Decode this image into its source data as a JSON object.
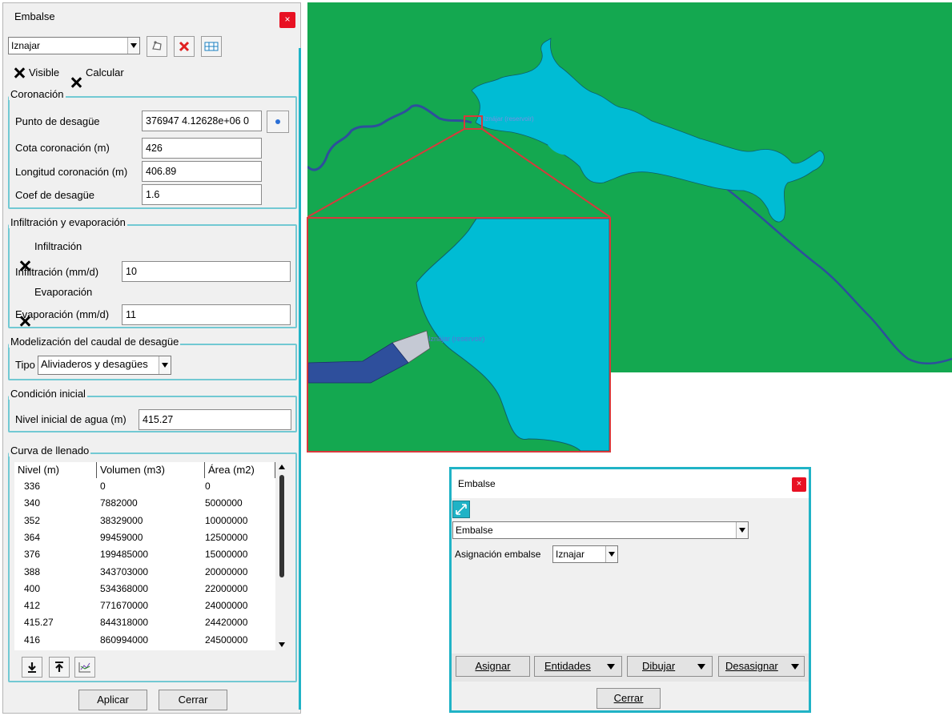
{
  "main_dialog": {
    "title": "Embalse",
    "close_glyph": "×",
    "reservoir_select": "Iznajar",
    "toolbar_icons": [
      "draw-polygon-icon",
      "delete-icon",
      "table-icon"
    ],
    "visible_label": "Visible",
    "calcular_label": "Calcular",
    "coronacion": {
      "title": "Coronación",
      "punto_label": "Punto de desagüe",
      "punto_value": "376947 4.12628e+06 0",
      "cota_label": "Cota coronación (m)",
      "cota_value": "426",
      "longitud_label": "Longitud coronación (m)",
      "longitud_value": "406.89",
      "coef_label": "Coef de desagüe",
      "coef_value": "1.6"
    },
    "infiltracion": {
      "title": "Infiltración y evaporación",
      "infil_check_label": "Infiltración",
      "infil_label": "Infiltración (mm/d)",
      "infil_value": "10",
      "evap_check_label": "Evaporación",
      "evap_label": "Evaporación (mm/d)",
      "evap_value": "11"
    },
    "modelizacion": {
      "title": "Modelización del caudal de desagüe",
      "tipo_label": "Tipo",
      "tipo_value": "Aliviaderos y desagües"
    },
    "condicion": {
      "title": "Condición inicial",
      "nivel_label": "Nivel inicial de agua (m)",
      "nivel_value": "415.27"
    },
    "curva": {
      "title": "Curva de llenado",
      "headers": [
        "Nivel (m)",
        "Volumen (m3)",
        "Área (m2)"
      ],
      "rows": [
        [
          "336",
          "0",
          "0"
        ],
        [
          "340",
          "7882000",
          "5000000"
        ],
        [
          "352",
          "38329000",
          "10000000"
        ],
        [
          "364",
          "99459000",
          "12500000"
        ],
        [
          "376",
          "199485000",
          "15000000"
        ],
        [
          "388",
          "343703000",
          "20000000"
        ],
        [
          "400",
          "534368000",
          "22000000"
        ],
        [
          "412",
          "771670000",
          "24000000"
        ],
        [
          "415.27",
          "844318000",
          "24420000"
        ],
        [
          "416",
          "860994000",
          "24500000"
        ]
      ],
      "bottom_icons": [
        "import-icon",
        "export-icon",
        "chart-icon"
      ]
    },
    "aplicar_label": "Aplicar",
    "cerrar_label": "Cerrar"
  },
  "map": {
    "label": "Iznájar (reservoir)"
  },
  "colors": {
    "land": "#14a850",
    "water": "#00bcd4",
    "river": "#2e4f9c",
    "dam": "#c5c9d4",
    "zoom_border": "#d8393c",
    "accent": "#20b3c6"
  },
  "assign_dialog": {
    "title": "Embalse",
    "close_glyph": "×",
    "layer_select": "Embalse",
    "asignacion_label": "Asignación embalse",
    "asignacion_value": "Iznajar",
    "asignar_label": "Asignar",
    "entidades_label": "Entidades",
    "dibujar_label": "Dibujar",
    "desasignar_label": "Desasignar",
    "cerrar_label": "Cerrar"
  }
}
